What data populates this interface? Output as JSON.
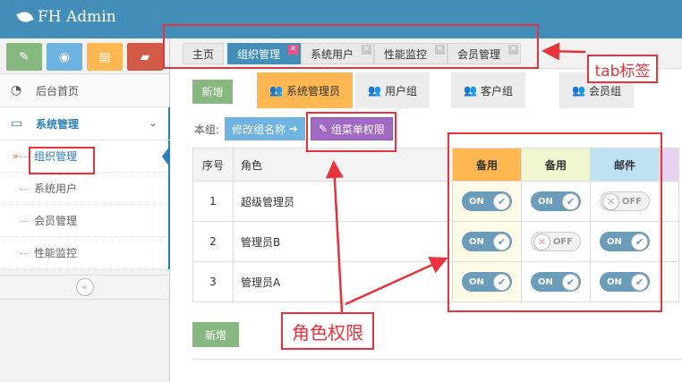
{
  "app": {
    "brand": "FH Admin"
  },
  "sidebar": {
    "shortcuts": [
      {
        "icon": "pencil-icon",
        "color": "#87b87f"
      },
      {
        "icon": "eye-icon",
        "color": "#6fb3e0"
      },
      {
        "icon": "book-icon",
        "color": "#ffb752"
      },
      {
        "icon": "folder-icon",
        "color": "#d15b47"
      }
    ],
    "home_label": "后台首页",
    "section_label": "系统管理",
    "items": [
      {
        "label": "组织管理"
      },
      {
        "label": "系统用户"
      },
      {
        "label": "会员管理"
      },
      {
        "label": "性能监控"
      }
    ]
  },
  "tabs": [
    {
      "label": "主页"
    },
    {
      "label": "组织管理"
    },
    {
      "label": "系统用户"
    },
    {
      "label": "性能监控"
    },
    {
      "label": "会员管理"
    }
  ],
  "toolbar": {
    "add_label": "新增",
    "add_bottom_label": "新增"
  },
  "role_groups": [
    {
      "label": "系统管理员"
    },
    {
      "label": "用户组"
    },
    {
      "label": "客户组"
    },
    {
      "label": "会员组"
    }
  ],
  "group": {
    "prefix": "本组:",
    "rename_label": "修改组名称",
    "menu_perm_label": "组菜单权限"
  },
  "table": {
    "headers": [
      "序号",
      "角色",
      "备用",
      "备用",
      "邮件"
    ],
    "rows": [
      {
        "no": "1",
        "role": "超级管理员",
        "perms": [
          "ON",
          "ON",
          "OFF"
        ]
      },
      {
        "no": "2",
        "role": "管理员B",
        "perms": [
          "ON",
          "OFF",
          "ON"
        ]
      },
      {
        "no": "3",
        "role": "管理员A",
        "perms": [
          "ON",
          "ON",
          "ON"
        ]
      }
    ]
  },
  "annotations": {
    "tab_label": "tab标签",
    "perm_label": "角色权限"
  },
  "colors": {
    "navbar": "#438eb9",
    "accent_red": "#e8323c"
  }
}
